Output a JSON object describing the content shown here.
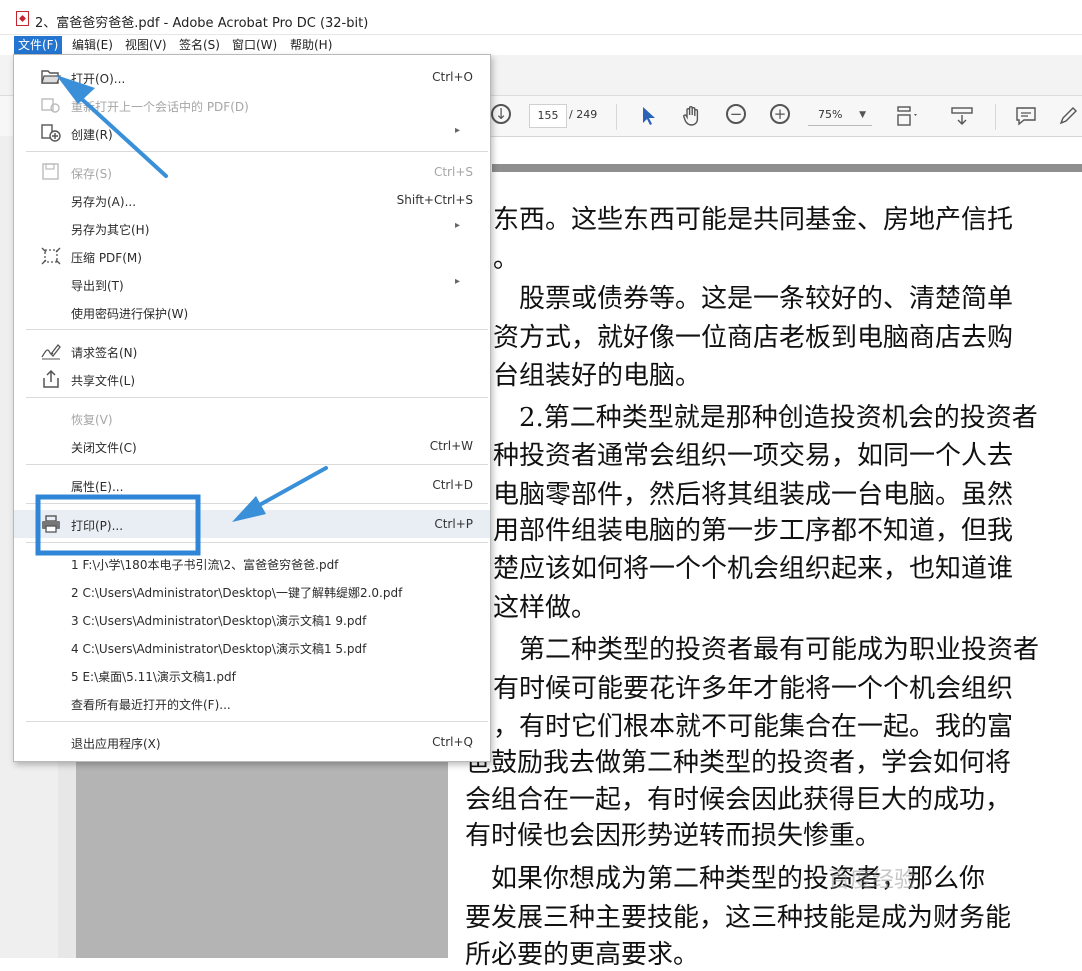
{
  "window": {
    "title": "2、富爸爸穷爸爸.pdf - Adobe Acrobat Pro DC (32-bit)"
  },
  "menubar": [
    {
      "label": "文件(F)",
      "active": true
    },
    {
      "label": "编辑(E)"
    },
    {
      "label": "视图(V)"
    },
    {
      "label": "签名(S)"
    },
    {
      "label": "窗口(W)"
    },
    {
      "label": "帮助(H)"
    }
  ],
  "toolbar": {
    "page_current": "155",
    "page_total": "/ 249",
    "zoom": "75%"
  },
  "file_menu": {
    "open": {
      "label": "打开(O)...",
      "shortcut": "Ctrl+O"
    },
    "reopen": {
      "label": "重新打开上一个会话中的 PDF(D)"
    },
    "create": {
      "label": "创建(R)"
    },
    "save": {
      "label": "保存(S)",
      "shortcut": "Ctrl+S"
    },
    "save_as": {
      "label": "另存为(A)...",
      "shortcut": "Shift+Ctrl+S"
    },
    "save_as_other": {
      "label": "另存为其它(H)"
    },
    "compress": {
      "label": "压缩 PDF(M)"
    },
    "export": {
      "label": "导出到(T)"
    },
    "protect": {
      "label": "使用密码进行保护(W)"
    },
    "request_sign": {
      "label": "请求签名(N)"
    },
    "share": {
      "label": "共享文件(L)"
    },
    "revert": {
      "label": "恢复(V)"
    },
    "close": {
      "label": "关闭文件(C)",
      "shortcut": "Ctrl+W"
    },
    "properties": {
      "label": "属性(E)...",
      "shortcut": "Ctrl+D"
    },
    "print": {
      "label": "打印(P)...",
      "shortcut": "Ctrl+P"
    },
    "recent": [
      "1 F:\\小学\\180本电子书引流\\2、富爸爸穷爸爸.pdf",
      "2 C:\\Users\\Administrator\\Desktop\\一键了解韩缇娜2.0.pdf",
      "3 C:\\Users\\Administrator\\Desktop\\演示文稿1 9.pdf",
      "4 C:\\Users\\Administrator\\Desktop\\演示文稿1 5.pdf",
      "5 E:\\桌面\\5.11\\演示文稿1.pdf"
    ],
    "view_all_recent": {
      "label": "查看所有最近打开的文件(F)..."
    },
    "exit": {
      "label": "退出应用程序(X)",
      "shortcut": "Ctrl+Q"
    }
  },
  "document": {
    "lines_right": [
      "东西。这些东西可能是共同基金、房地产信托",
      "。",
      "　股票或债券等。这是一条较好的、清楚简单",
      "资方式，就好像一位商店老板到电脑商店去购",
      "台组装好的电脑。",
      "　2.第二种类型就是那种创造投资机会的投资者",
      "种投资者通常会组织一项交易，如同一个人去",
      "电脑零部件，然后将其组装成一台电脑。虽然",
      "用部件组装电脑的第一步工序都不知道，但我",
      "楚应该如何将一个个机会组织起来，也知道谁",
      "这样做。",
      "　第二种类型的投资者最有可能成为职业投资者",
      "有时候可能要花许多年才能将一个个机会组织",
      "，有时它们根本就不可能集合在一起。我的富"
    ],
    "lines_wide": [
      "爸鼓励我去做第二种类型的投资者，学会如何将",
      "会组合在一起，有时候会因此获得巨大的成功，",
      "有时候也会因形势逆转而损失惨重。",
      "　如果你想成为第二种类型的投资者，那么你",
      "要发展三种主要技能，这三种技能是成为财务能",
      "所必要的更高要求。"
    ]
  },
  "watermark": "百度经验",
  "colors": {
    "menu_active": "#2475d1",
    "annotation": "#3a8fd9"
  }
}
